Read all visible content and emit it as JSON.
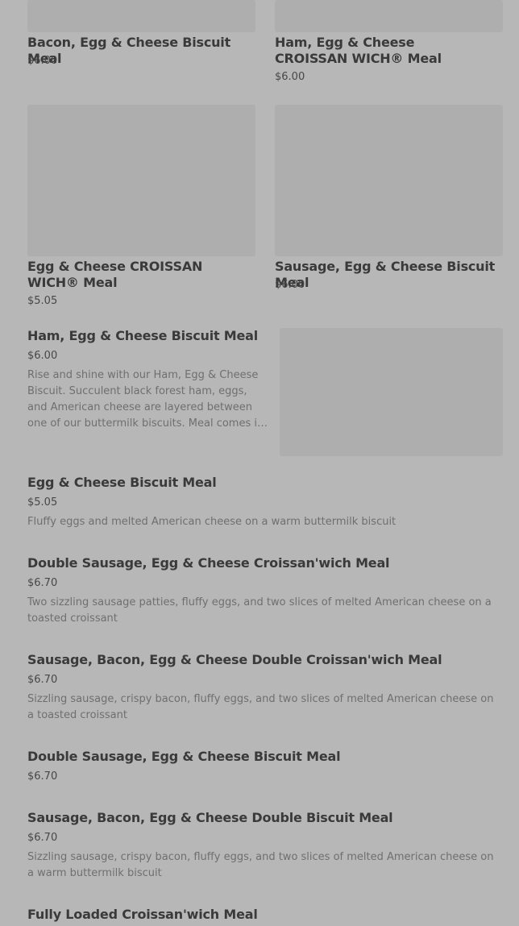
{
  "grid": [
    {
      "title": "Bacon, Egg & Cheese Biscuit Meal",
      "price": "$6.00"
    },
    {
      "title": "Ham, Egg & Cheese CROISSAN WICH® Meal",
      "price": "$6.00"
    },
    {
      "title": "Egg & Cheese CROISSAN WICH® Meal",
      "price": "$5.05"
    },
    {
      "title": "Sausage, Egg & Cheese Biscuit Meal",
      "price": "$6.00"
    }
  ],
  "featured": {
    "title": "Ham, Egg & Cheese Biscuit Meal",
    "price": "$6.00",
    "desc": "Rise and shine with our Ham, Egg & Cheese Biscuit. Succulent black forest ham, eggs, and American cheese are layered between one of our buttermilk biscuits. Meal comes in medium size with hash browns and a drink."
  },
  "list": [
    {
      "title": "Egg & Cheese Biscuit Meal",
      "price": "$5.05",
      "desc": "Fluffy eggs and melted American cheese on a warm buttermilk biscuit"
    },
    {
      "title": "Double Sausage, Egg & Cheese Croissan'wich Meal",
      "price": "$6.70",
      "desc": "Two sizzling sausage patties, fluffy eggs, and two slices of melted American cheese on a toasted croissant"
    },
    {
      "title": "Sausage, Bacon, Egg & Cheese Double Croissan'wich Meal",
      "price": "$6.70",
      "desc": "Sizzling sausage, crispy bacon, fluffy eggs, and two slices of melted American cheese on a toasted croissant"
    },
    {
      "title": "Double Sausage, Egg & Cheese Biscuit Meal",
      "price": "$6.70"
    },
    {
      "title": "Sausage, Bacon, Egg & Cheese Double Biscuit Meal",
      "price": "$6.70",
      "desc": "Sizzling sausage, crispy bacon, fluffy eggs, and two slices of melted American cheese on a warm buttermilk biscuit"
    },
    {
      "title": "Fully Loaded Croissan'wich Meal"
    }
  ]
}
